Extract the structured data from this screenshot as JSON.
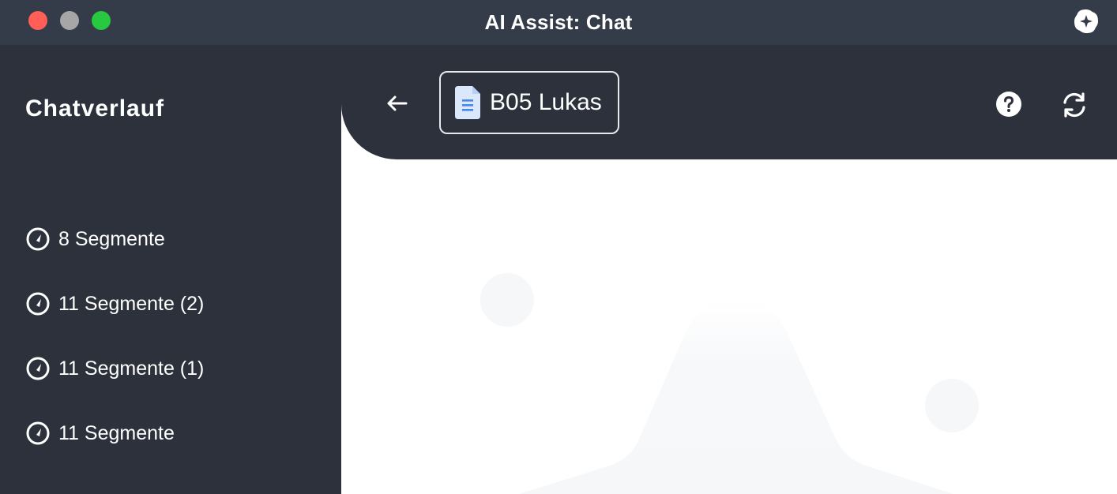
{
  "window": {
    "title": "AI Assist: Chat",
    "app_icon": "app-logo-icon"
  },
  "sidebar": {
    "title": "Chatverlauf",
    "items": [
      {
        "label": "8 Segmente",
        "icon": "gauge-icon"
      },
      {
        "label": "11 Segmente (2)",
        "icon": "gauge-icon"
      },
      {
        "label": "11 Segmente (1)",
        "icon": "gauge-icon"
      },
      {
        "label": "11 Segmente",
        "icon": "gauge-icon"
      }
    ]
  },
  "header": {
    "back_icon": "back-arrow-icon",
    "document": {
      "label": "B05 Lukas",
      "icon": "document-icon"
    },
    "help_icon": "help-icon",
    "refresh_icon": "refresh-icon"
  },
  "colors": {
    "titlebar": "#343c4a",
    "sidebar": "#2c313c",
    "accent_doc": "#4a86e8",
    "close": "#ff5f57",
    "minimize": "#a6a6a6",
    "maximize": "#28c840"
  }
}
